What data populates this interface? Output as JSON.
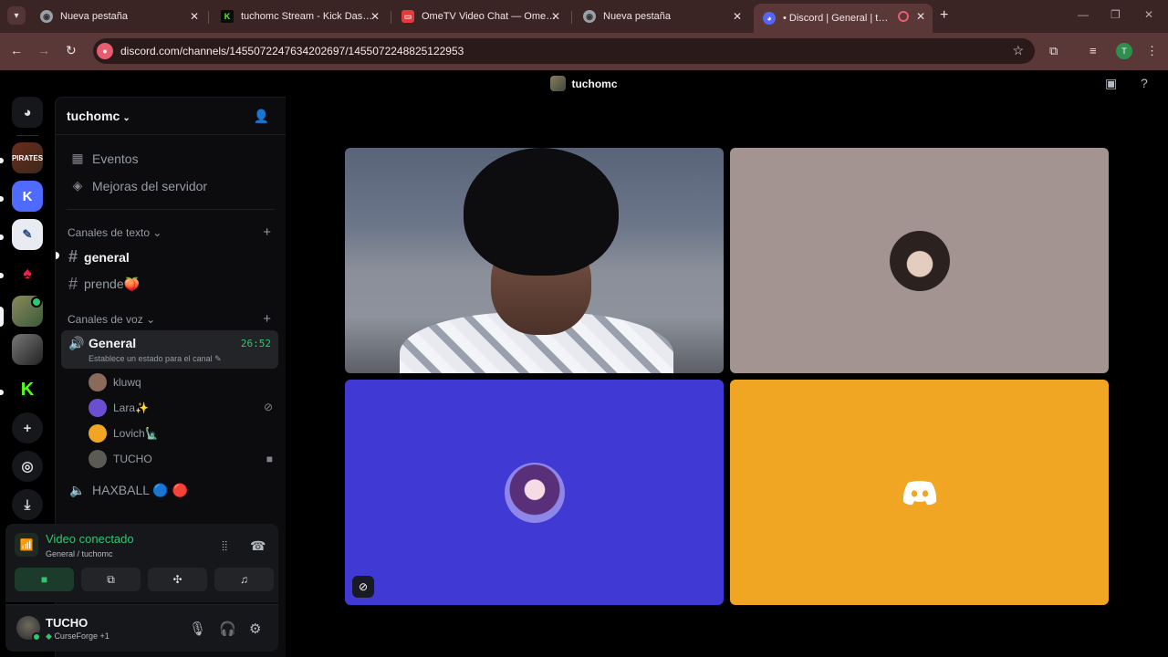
{
  "browser": {
    "tabs": [
      {
        "title": "Nueva pestaña",
        "favicon": "chrome-icon"
      },
      {
        "title": "tuchomc Stream - Kick Dashboard",
        "favicon": "kick-icon"
      },
      {
        "title": "OmeTV Video Chat — Omegle",
        "favicon": "ometv-icon"
      },
      {
        "title": "Nueva pestaña",
        "favicon": "chrome-icon"
      },
      {
        "title": "• Discord | General | tuchomc",
        "favicon": "discord-icon",
        "active": true
      }
    ],
    "url": "discord.com/channels/1455072247634202697/1455072248825122953",
    "profile_initial": "T"
  },
  "discord": {
    "top_title": "tuchomc",
    "server_name": "tuchomc",
    "menu": [
      {
        "label": "Eventos",
        "icon": "calendar-icon"
      },
      {
        "label": "Mejoras del servidor",
        "icon": "boost-icon"
      }
    ],
    "text_category": "Canales de texto",
    "text_channels": [
      {
        "name": "general"
      },
      {
        "name": "prende🍑"
      }
    ],
    "voice_category": "Canales de voz",
    "active_voice": {
      "name": "General",
      "timer": "26:52",
      "status": "Establece un estado para el canal"
    },
    "members": [
      {
        "name": "kluwq",
        "color": "#8a6a5a"
      },
      {
        "name": "Lara✨",
        "color": "#6b4fd1"
      },
      {
        "name": "Lovich🗽",
        "color": "#f1a623"
      },
      {
        "name": "TUCHO",
        "color": "#5c5a55"
      }
    ],
    "other_voice": "HAXBALL 🔵 🔴",
    "voice_panel": {
      "status": "Video conectado",
      "sub": "General / tuchomc"
    },
    "user": {
      "name": "TUCHO",
      "activity": "CurseForge +1"
    },
    "colors": {
      "accent_green": "#2dc770",
      "tile_gray": "#a39391",
      "tile_blue": "#4039d4",
      "tile_orange": "#f1a623"
    }
  }
}
